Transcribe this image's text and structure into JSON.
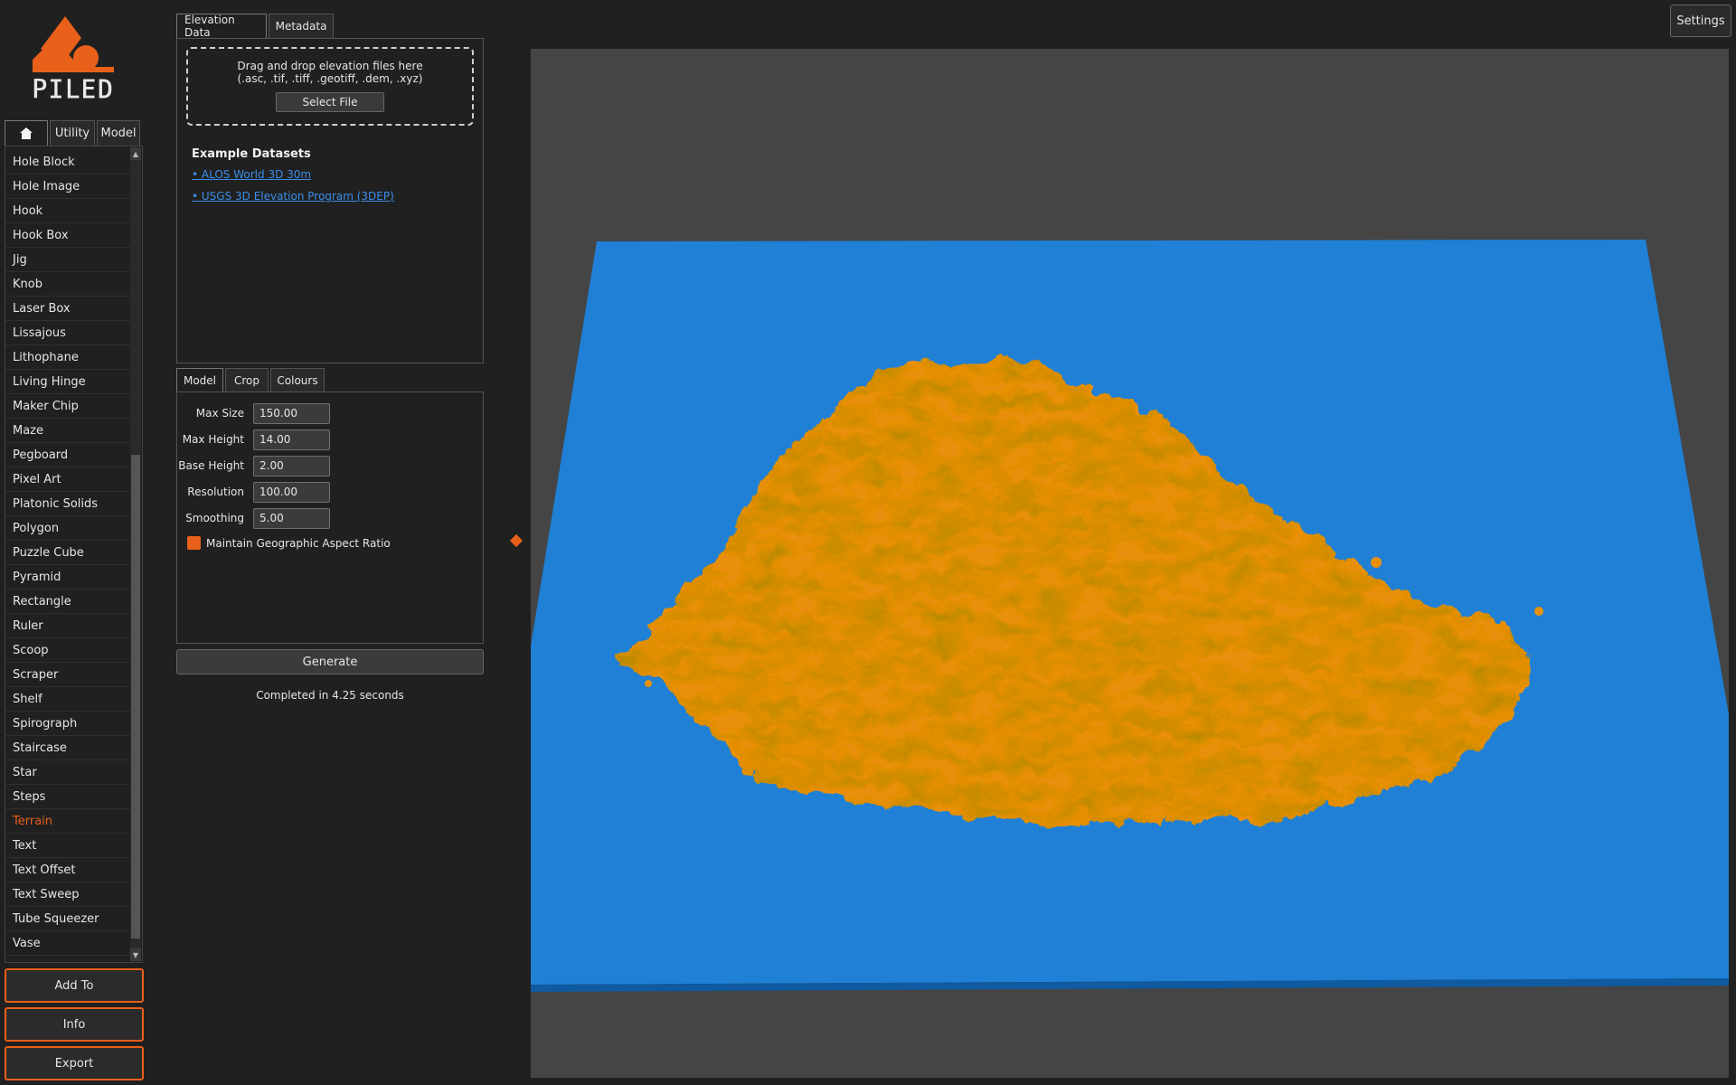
{
  "logo": {
    "text": "PILED",
    "icon": "piled-logo"
  },
  "left_tabs": {
    "home_icon": "home-icon",
    "utility_label": "Utility",
    "model_label": "Model"
  },
  "items": [
    "Hole Block",
    "Hole Image",
    "Hook",
    "Hook Box",
    "Jig",
    "Knob",
    "Laser Box",
    "Lissajous",
    "Lithophane",
    "Living Hinge",
    "Maker Chip",
    "Maze",
    "Pegboard",
    "Pixel Art",
    "Platonic Solids",
    "Polygon",
    "Puzzle Cube",
    "Pyramid",
    "Rectangle",
    "Ruler",
    "Scoop",
    "Scraper",
    "Shelf",
    "Spirograph",
    "Staircase",
    "Star",
    "Steps",
    "Terrain",
    "Text",
    "Text Offset",
    "Text Sweep",
    "Tube Squeezer",
    "Vase"
  ],
  "selected_item": "Terrain",
  "buttons": {
    "add_to": "Add To",
    "info": "Info",
    "export": "Export"
  },
  "top_tabs": {
    "elevation": "Elevation Data",
    "metadata": "Metadata"
  },
  "dropzone": {
    "line1": "Drag and drop elevation files here",
    "line2": "(.asc, .tif, .tiff, .geotiff, .dem, .xyz)",
    "select_label": "Select File"
  },
  "examples": {
    "title": "Example Datasets",
    "link1": "• ALOS World 3D 30m",
    "link2": "• USGS 3D Elevation Program (3DEP)"
  },
  "mid_tabs": {
    "model": "Model",
    "crop": "Crop",
    "colours": "Colours"
  },
  "fields": {
    "max_size": {
      "label": "Max Size",
      "value": "150.00"
    },
    "max_height": {
      "label": "Max Height",
      "value": "14.00"
    },
    "base_height": {
      "label": "Base Height",
      "value": "2.00"
    },
    "resolution": {
      "label": "Resolution",
      "value": "100.00"
    },
    "smoothing": {
      "label": "Smoothing",
      "value": "5.00"
    }
  },
  "checkbox": {
    "label": "Maintain Geographic Aspect Ratio",
    "checked": true
  },
  "generate_label": "Generate",
  "status": "Completed in 4.25 seconds",
  "settings_label": "Settings",
  "colors": {
    "accent": "#e8601a",
    "terrain": "#e8900c",
    "water": "#1f80d6",
    "viewport_bg": "#454545",
    "app_bg": "#202020",
    "link": "#3b8eea"
  }
}
